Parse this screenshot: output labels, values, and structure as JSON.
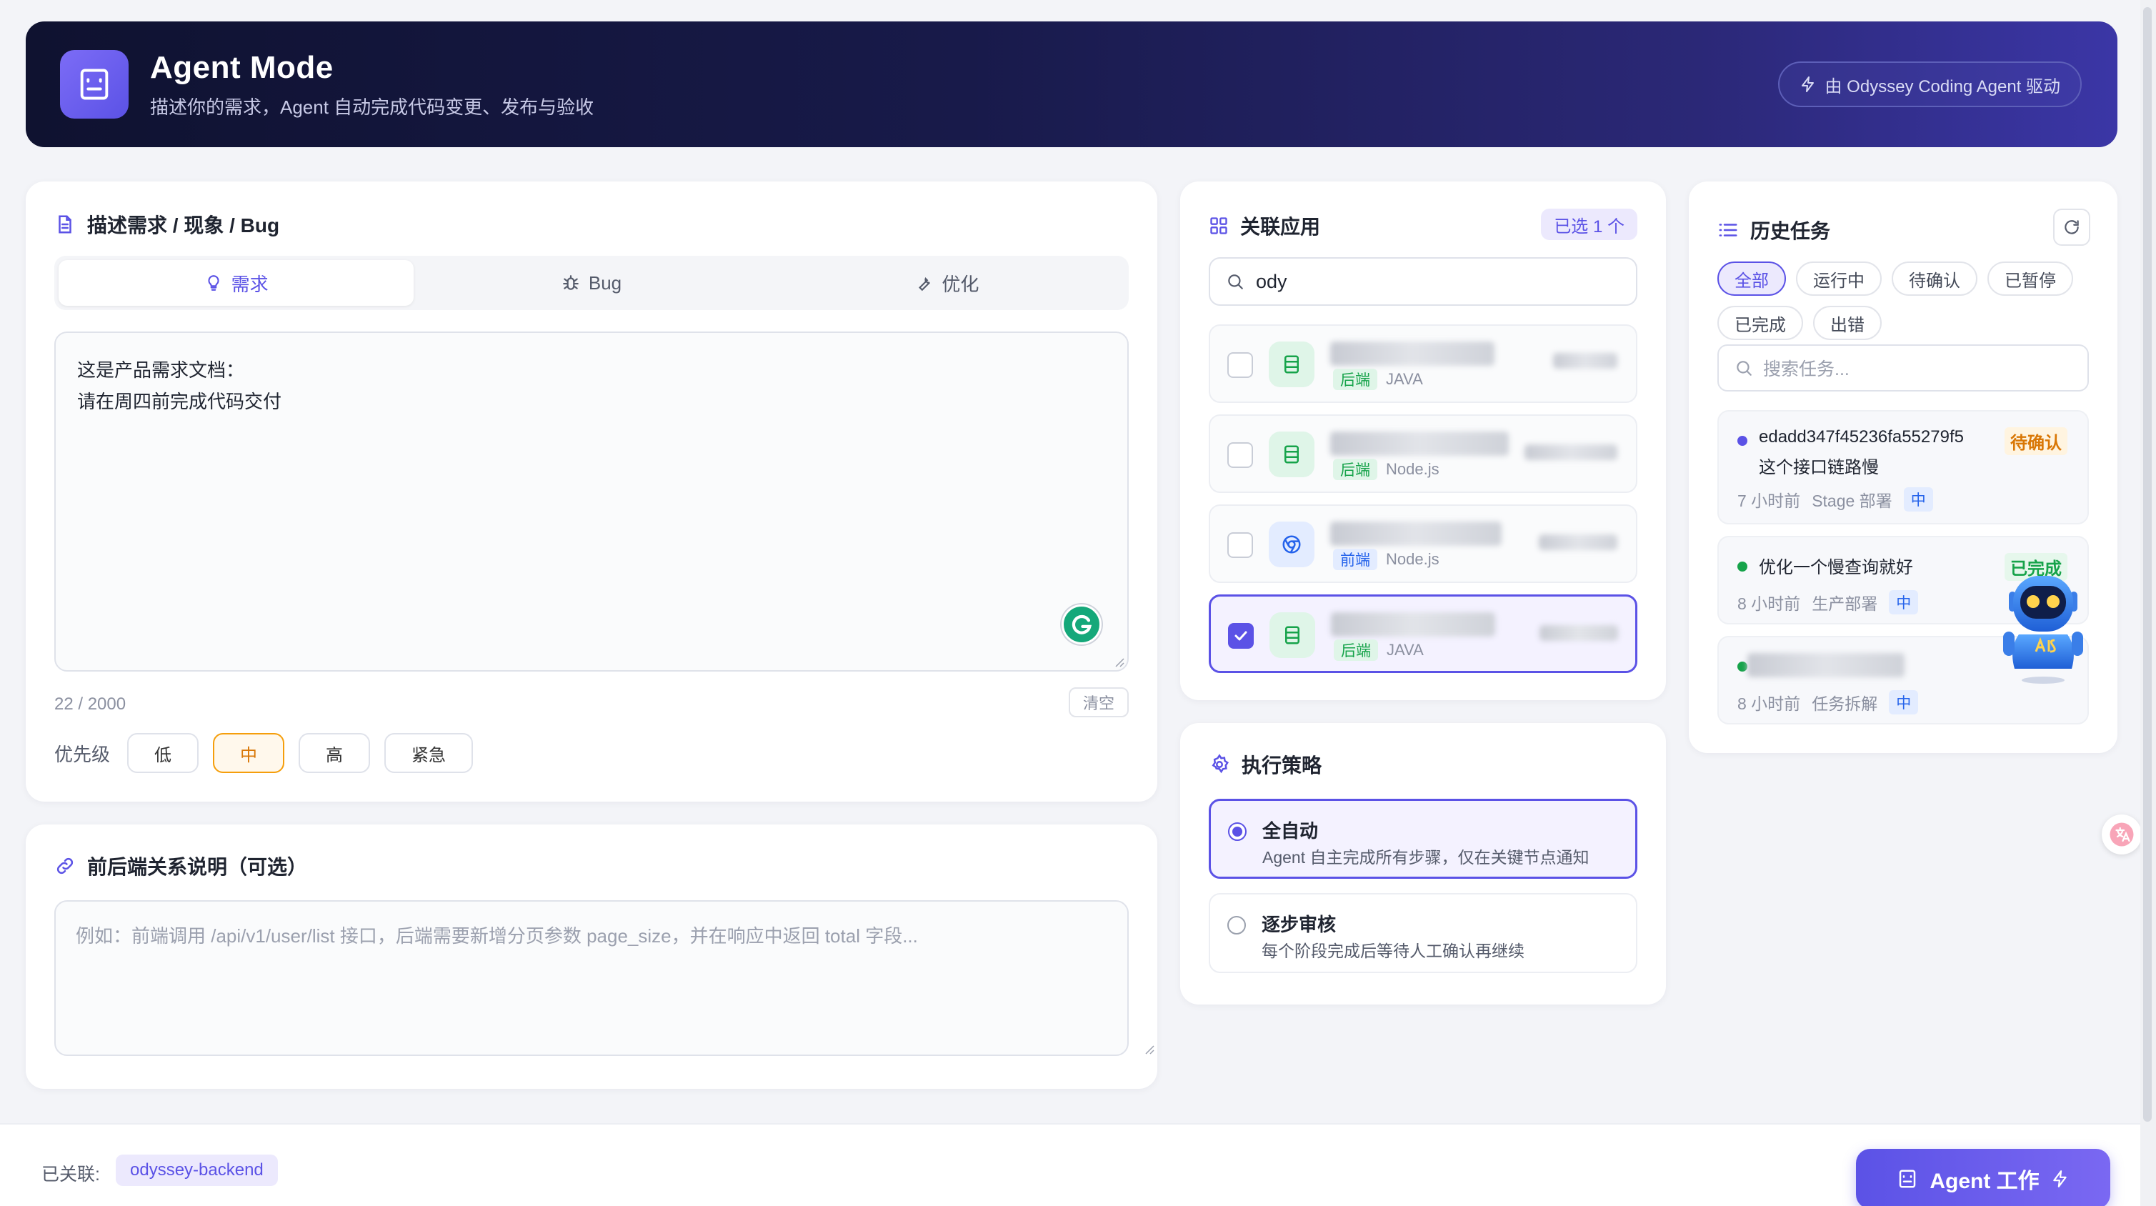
{
  "header": {
    "title": "Agent Mode",
    "subtitle": "描述你的需求，Agent 自动完成代码变更、发布与验收",
    "badge": "由 Odyssey Coding Agent 驱动"
  },
  "requirement": {
    "title": "描述需求 / 现象 / Bug",
    "tabs": [
      {
        "label": "需求",
        "icon": "lightbulb-icon",
        "active": true
      },
      {
        "label": "Bug",
        "icon": "bug-icon",
        "active": false
      },
      {
        "label": "优化",
        "icon": "wrench-icon",
        "active": false
      }
    ],
    "text_line1": "这是产品需求文档：",
    "text_line2": "请在周四前完成代码交付",
    "char_count": "22 / 2000",
    "clear_label": "清空",
    "priority_label": "优先级",
    "priorities": [
      "低",
      "中",
      "高",
      "紧急"
    ],
    "priority_selected": "中"
  },
  "relation": {
    "title": "前后端关系说明（可选）",
    "placeholder": "例如：前端调用 /api/v1/user/list 接口，后端需要新增分页参数 page_size，并在响应中返回 total 字段..."
  },
  "apps": {
    "title": "关联应用",
    "selected_badge": "已选 1 个",
    "search_value": "ody",
    "items": [
      {
        "tag": "后端",
        "lang": "JAVA",
        "checked": false,
        "kind": "be"
      },
      {
        "tag": "后端",
        "lang": "Node.js",
        "checked": false,
        "kind": "be"
      },
      {
        "tag": "前端",
        "lang": "Node.js",
        "checked": false,
        "kind": "fe"
      },
      {
        "tag": "后端",
        "lang": "JAVA",
        "checked": true,
        "kind": "be"
      }
    ]
  },
  "strategy": {
    "title": "执行策略",
    "options": [
      {
        "title": "全自动",
        "desc": "Agent 自主完成所有步骤，仅在关键节点通知",
        "selected": true
      },
      {
        "title": "逐步审核",
        "desc": "每个阶段完成后等待人工确认再继续",
        "selected": false
      }
    ]
  },
  "history": {
    "title": "历史任务",
    "filters": [
      "全部",
      "运行中",
      "待确认",
      "已暂停",
      "已完成",
      "出错"
    ],
    "active_filter": "全部",
    "search_placeholder": "搜索任务...",
    "tasks": [
      {
        "title": "edadd347f45236fa55279f5",
        "title2": "这个接口链路慢",
        "status": "待确认",
        "time": "7 小时前",
        "stage": "Stage 部署",
        "level": "中",
        "dot": "#5b52e6",
        "status_color": "#d97706",
        "status_bg": "#fff4e0"
      },
      {
        "title": "优化一个慢查询就好",
        "title2": "",
        "status": "已完成",
        "time": "8 小时前",
        "stage": "生产部署",
        "level": "中",
        "dot": "#16a34a",
        "status_color": "#16a34a",
        "status_bg": "#e6f7ec"
      },
      {
        "title": "",
        "title2": "",
        "status": "",
        "time": "8 小时前",
        "stage": "任务拆解",
        "level": "中",
        "dot": "#16a34a",
        "status_color": "#16a34a",
        "status_bg": "transparent"
      }
    ]
  },
  "bottom": {
    "linked_label": "已关联:",
    "linked_app": "odyssey-backend",
    "agent_button": "Agent 工作"
  },
  "colors": {
    "accent": "#5b52e6",
    "priority_active": "#f59e0b",
    "backend_tag": "#16a34a",
    "frontend_tag": "#2563eb"
  }
}
